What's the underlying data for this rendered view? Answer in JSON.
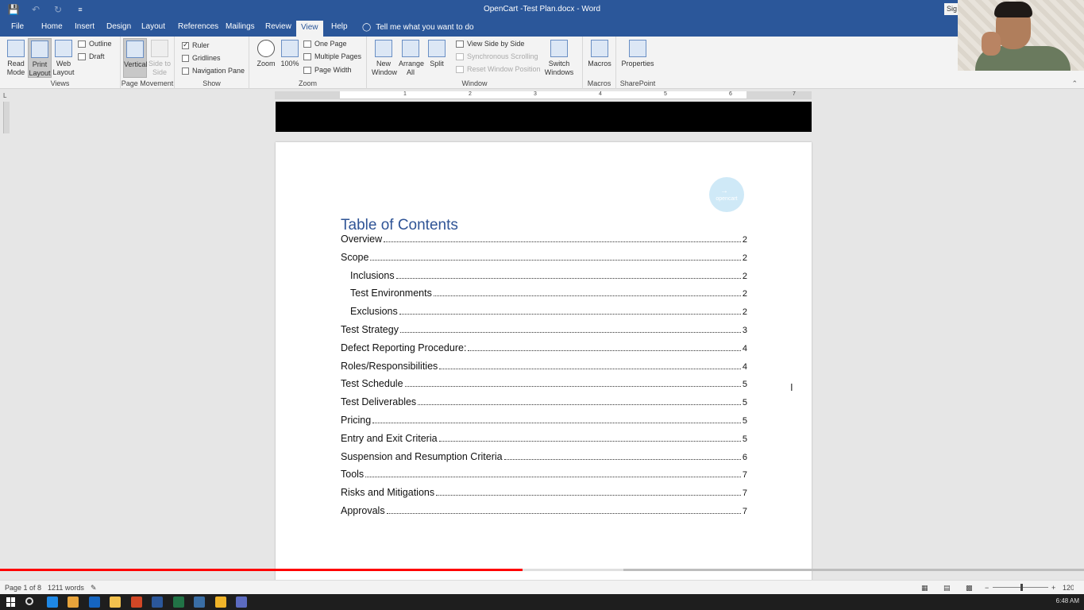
{
  "window": {
    "title": "OpenCart -Test Plan.docx  -  Word",
    "signin_label": "Sig"
  },
  "tabs": [
    "File",
    "Home",
    "Insert",
    "Design",
    "Layout",
    "References",
    "Mailings",
    "Review",
    "View",
    "Help"
  ],
  "active_tab": "View",
  "tell_me": "Tell me what you want to do",
  "ribbon": {
    "views": {
      "label": "Views",
      "read_mode": "Read Mode",
      "print_layout": "Print Layout",
      "web_layout": "Web Layout",
      "outline": "Outline",
      "draft": "Draft"
    },
    "page_movement": {
      "label": "Page Movement",
      "vertical": "Vertical",
      "side_to_side": "Side to Side"
    },
    "show": {
      "label": "Show",
      "ruler": "Ruler",
      "gridlines": "Gridlines",
      "navigation_pane": "Navigation Pane",
      "ruler_checked": true,
      "gridlines_checked": false,
      "navigation_pane_checked": false
    },
    "zoom": {
      "label": "Zoom",
      "zoom": "Zoom",
      "hundred": "100%",
      "one_page": "One Page",
      "multiple_pages": "Multiple Pages",
      "page_width": "Page Width"
    },
    "window": {
      "label": "Window",
      "new_window": "New Window",
      "arrange_all": "Arrange All",
      "split": "Split",
      "view_side_by_side": "View Side by Side",
      "synchronous_scrolling": "Synchronous Scrolling",
      "reset_window_position": "Reset Window Position",
      "switch_windows": "Switch Windows"
    },
    "macros": {
      "label": "Macros",
      "macros": "Macros"
    },
    "sharepoint": {
      "label": "SharePoint",
      "properties": "Properties"
    }
  },
  "ruler_numbers": [
    "1",
    "2",
    "3",
    "4",
    "5",
    "6",
    "7"
  ],
  "logo_text": "opencart",
  "document": {
    "toc_heading": "Table of Contents",
    "toc": [
      {
        "title": "Overview",
        "page": "2",
        "level": 1
      },
      {
        "title": "Scope",
        "page": "2",
        "level": 1
      },
      {
        "title": "Inclusions",
        "page": "2",
        "level": 2
      },
      {
        "title": "Test Environments",
        "page": "2",
        "level": 2
      },
      {
        "title": "Exclusions",
        "page": "2",
        "level": 2
      },
      {
        "title": "Test Strategy",
        "page": "3",
        "level": 1
      },
      {
        "title": "Defect Reporting Procedure:",
        "page": "4",
        "level": 1
      },
      {
        "title": "Roles/Responsibilities",
        "page": "4",
        "level": 1
      },
      {
        "title": "Test Schedule",
        "page": "5",
        "level": 1
      },
      {
        "title": "Test Deliverables",
        "page": "5",
        "level": 1
      },
      {
        "title": "Pricing",
        "page": "5",
        "level": 1
      },
      {
        "title": "Entry and Exit Criteria",
        "page": "5",
        "level": 1
      },
      {
        "title": "Suspension and Resumption Criteria",
        "page": "6",
        "level": 1
      },
      {
        "title": "Tools",
        "page": "7",
        "level": 1
      },
      {
        "title": "Risks and Mitigations",
        "page": "7",
        "level": 1
      },
      {
        "title": "Approvals",
        "page": "7",
        "level": 1
      }
    ]
  },
  "status": {
    "page": "Page 1 of 8",
    "words": "1211 words",
    "zoom": "120"
  },
  "video_progress": {
    "played": 0.482,
    "buffered_to": 0.575
  },
  "taskbar": {
    "clock": "6:48 AM",
    "icons": [
      "search-icon",
      "edge-icon",
      "chrome-icon",
      "store-icon",
      "file-explorer-icon",
      "powerpoint-icon",
      "word-icon",
      "excel-icon",
      "app-icon",
      "folder-icon",
      "app2-icon"
    ]
  },
  "colors": {
    "word_blue": "#2b579a",
    "toc_heading": "#2f5496",
    "progress_red": "#ff0000"
  }
}
